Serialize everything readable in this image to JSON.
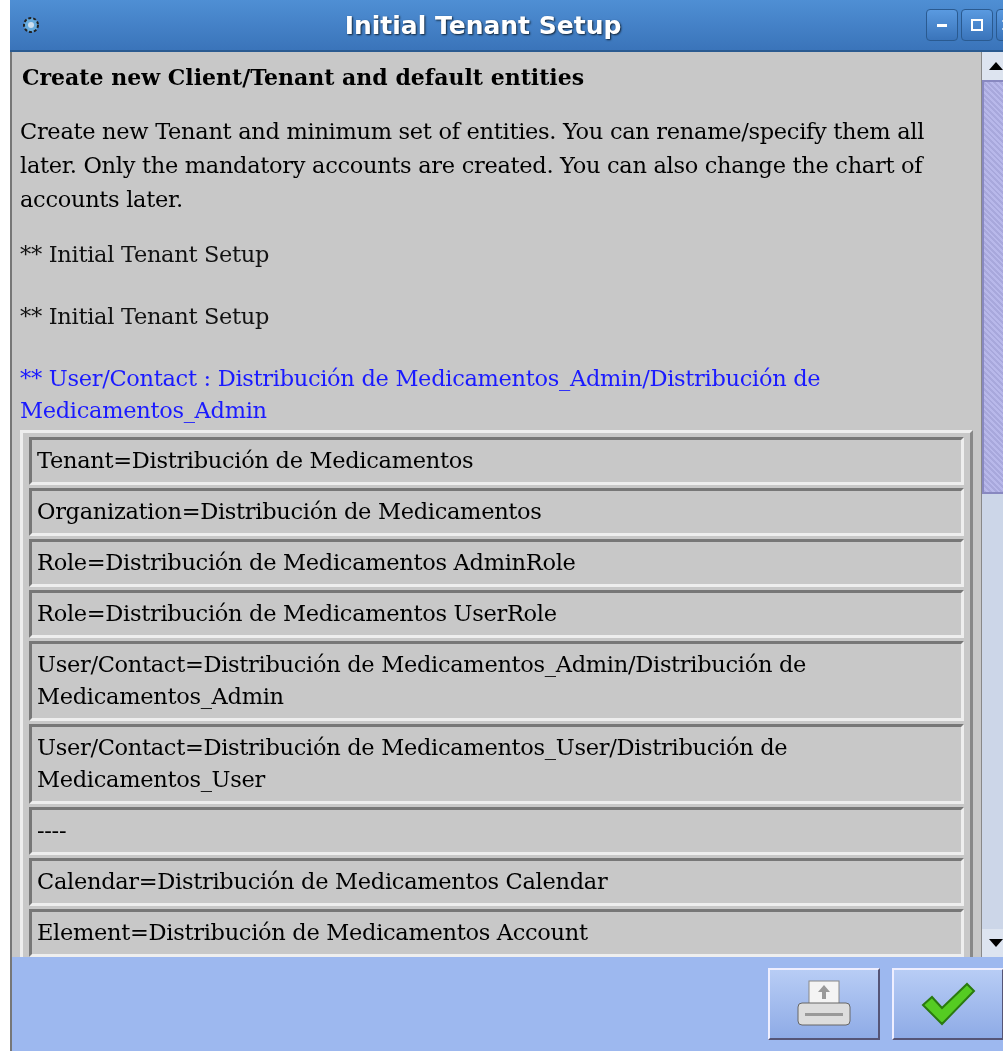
{
  "window": {
    "title": "Initial Tenant Setup"
  },
  "heading": "Create new Client/Tenant and default entities",
  "description": "Create new Tenant and minimum set of entities. You can rename/specify them all later. Only the mandatory accounts are created. You can also change the chart of accounts later.",
  "messages": [
    {
      "text": "** Initial Tenant Setup",
      "kind": "info"
    },
    {
      "text": "** Initial Tenant Setup",
      "kind": "info"
    },
    {
      "text": "** User/Contact : Distribución de Medicamentos_Admin/Distribución de Medicamentos_Admin",
      "kind": "link"
    }
  ],
  "rows": [
    "Tenant=Distribución de Medicamentos",
    "Organization=Distribución de Medicamentos",
    "Role=Distribución de Medicamentos AdminRole",
    "Role=Distribución de Medicamentos UserRole",
    "User/Contact=Distribución de Medicamentos_Admin/Distribución de Medicamentos_Admin",
    "User/Contact=Distribución de Medicamentos_User/Distribución de Medicamentos_User",
    "----",
    "Calendar=Distribución de Medicamentos Calendar",
    "Element=Distribución de Medicamentos Account"
  ]
}
